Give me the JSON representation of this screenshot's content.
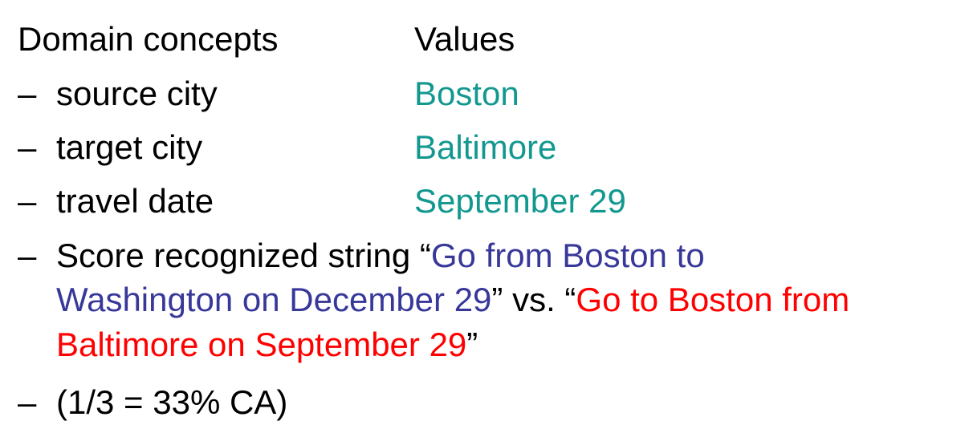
{
  "header": {
    "concepts_label": "Domain concepts",
    "values_label": "Values"
  },
  "dash": "–",
  "rows": [
    {
      "concept": "source city",
      "value": "Boston"
    },
    {
      "concept": "target city",
      "value": "Baltimore"
    },
    {
      "concept": "travel date",
      "value": "September 29"
    }
  ],
  "score": {
    "prefix": "Score recognized string “",
    "recognized_part1": "Go from Boston to",
    "recognized_part2": "Washington on December 29",
    "middle": "” vs. “",
    "reference_part1": "Go to Boston from",
    "reference_part2": "Baltimore on September 29",
    "suffix": "”"
  },
  "result": "(1/3 = 33% CA)",
  "colors": {
    "value_teal": "#13988f",
    "recognized_blue": "#38389a",
    "reference_red": "#ff0000"
  }
}
